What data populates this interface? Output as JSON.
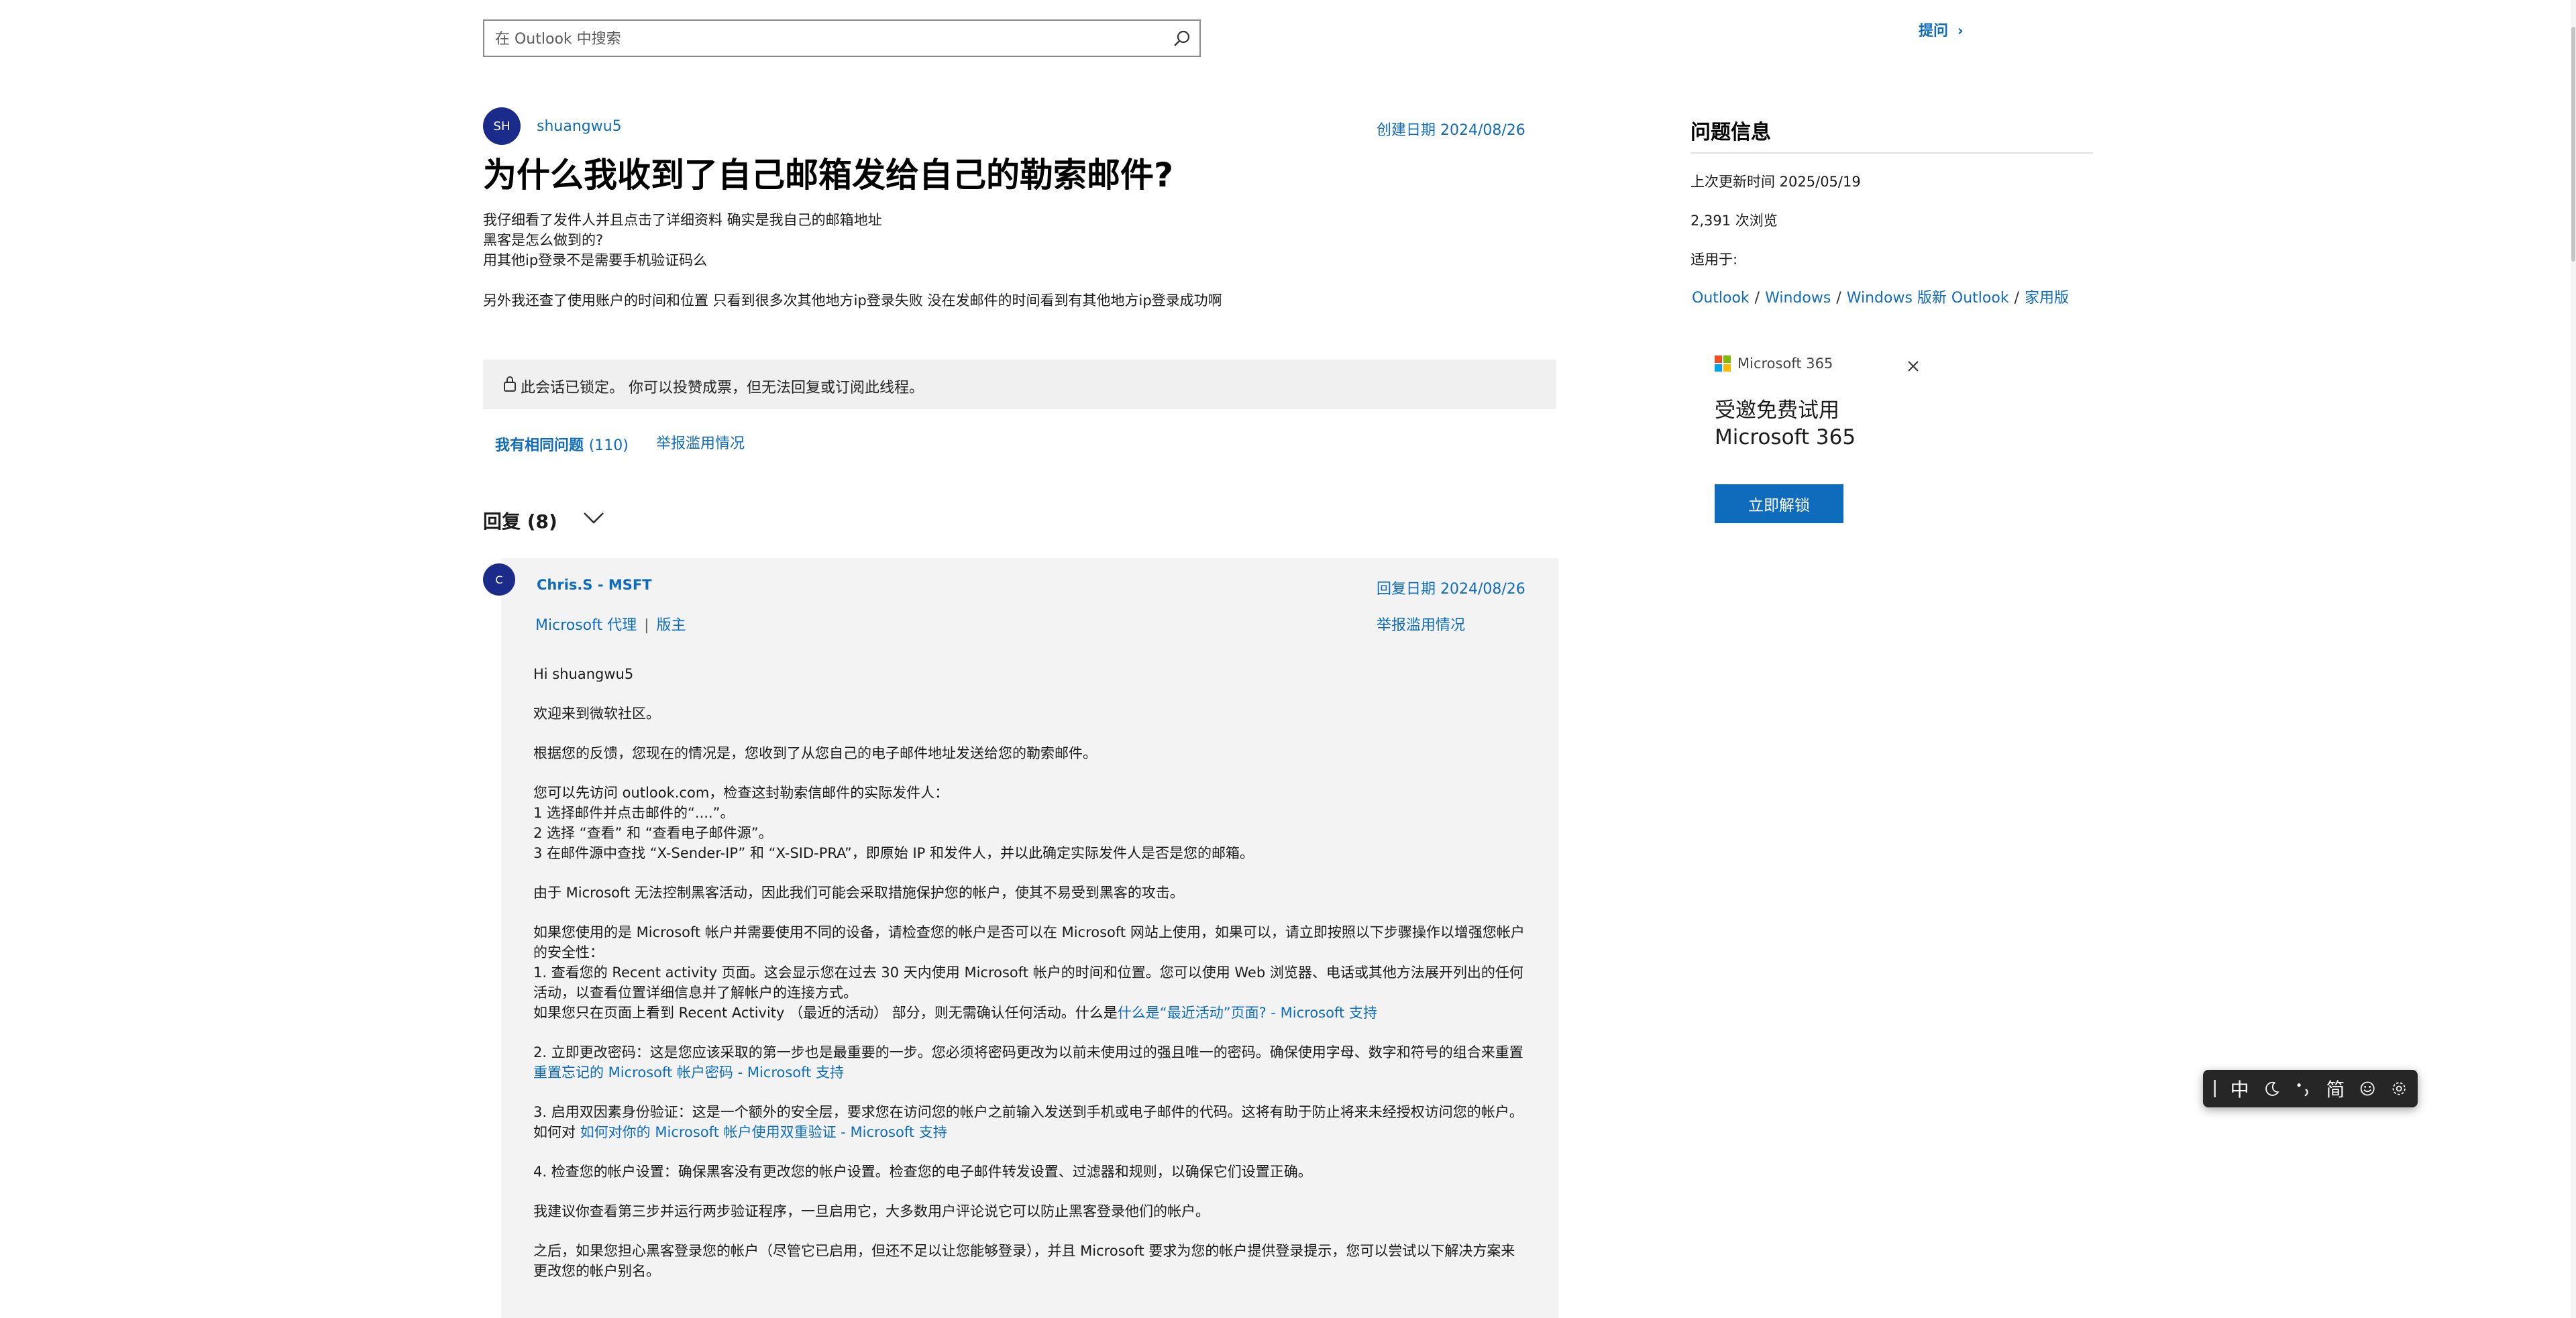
{
  "search": {
    "placeholder": "在 Outlook 中搜索"
  },
  "header": {
    "ask_label": "提问"
  },
  "question": {
    "avatar_initials": "SH",
    "author": "shuangwu5",
    "created": "创建日期 2024/08/26",
    "title": "为什么我收到了自己邮箱发给自己的勒索邮件?",
    "body_lines": [
      "我仔细看了发件人并且点击了详细资料 确实是我自己的邮箱地址",
      "黑客是怎么做到的?",
      "用其他ip登录不是需要手机验证码么",
      "另外我还查了使用账户的时间和位置 只看到很多次其他地方ip登录失败 没在发邮件的时间看到有其他地方ip登录成功啊"
    ],
    "locked_notice": "此会话已锁定。 你可以投赞成票，但无法回复或订阅此线程。",
    "same_question_label": "我有相同问题",
    "same_question_count": "(110)",
    "report_label": "举报滥用情况"
  },
  "replies": {
    "header": "回复 (8)",
    "first": {
      "avatar_initials": "C",
      "author": "Chris.S - MSFT",
      "reply_date": "回复日期 2024/08/26",
      "role": "Microsoft 代理",
      "role2": "版主",
      "report_label": "举报滥用情况",
      "p1": "Hi shuangwu5",
      "p2": "欢迎来到微软社区。",
      "p3": "根据您的反馈，您现在的情况是，您收到了从您自己的电子邮件地址发送给您的勒索邮件。",
      "p4_l1": "您可以先访问 outlook.com，检查这封勒索信邮件的实际发件人：",
      "p4_l2": "1 选择邮件并点击邮件的“....”。",
      "p4_l3": "2 选择 “查看” 和 “查看电子邮件源”。",
      "p4_l4": "3 在邮件源中查找 “X-Sender-IP” 和 “X-SID-PRA”，即原始 IP 和发件人，并以此确定实际发件人是否是您的邮箱。",
      "p5": "由于 Microsoft 无法控制黑客活动，因此我们可能会采取措施保护您的帐户，使其不易受到黑客的攻击。",
      "p6_l1": "如果您使用的是 Microsoft 帐户并需要使用不同的设备，请检查您的帐户是否可以在 Microsoft 网站上使用，如果可以，请立即按照以下步骤操作以增强您帐户的安全性：",
      "p6_l2": "1. 查看您的 Recent activity 页面。这会显示您在过去 30 天内使用 Microsoft 帐户的时间和位置。您可以使用 Web 浏览器、电话或其他方法展开列出的任何活动，以查看位置详细信息并了解帐户的连接方式。",
      "p6_l3": "如果您只在页面上看到 Recent Activity （最近的活动） 部分，则无需确认任何活动。什么是",
      "p6_link": "什么是“最近活动”页面? - Microsoft 支持",
      "p7_text": "2. 立即更改密码：这是您应该采取的第一步也是最重要的一步。您必须将密码更改为以前未使用过的强且唯一的密码。确保使用字母、数字和符号的组合来重置",
      "p7_link": "重置忘记的 Microsoft 帐户密码 - Microsoft 支持",
      "p8_text": "3. 启用双因素身份验证：这是一个额外的安全层，要求您在访问您的帐户之前输入发送到手机或电子邮件的代码。这将有助于防止将来未经授权访问您的帐户。如何对 ",
      "p8_link": "如何对你的 Microsoft 帐户使用双重验证 - Microsoft 支持",
      "p9": "4. 检查您的帐户设置：确保黑客没有更改您的帐户设置。检查您的电子邮件转发设置、过滤器和规则，以确保它们设置正确。",
      "p10": "我建议你查看第三步并运行两步验证程序，一旦启用它，大多数用户评论说它可以防止黑客登录他们的帐户。",
      "p11": "之后，如果您担心黑客登录您的帐户（尽管它已启用，但还不足以让您能够登录），并且 Microsoft 要求为您的帐户提供登录提示，您可以尝试以下解决方案来更改您的帐户别名。"
    }
  },
  "sidebar": {
    "title": "问题信息",
    "last_updated": "上次更新时间 2025/05/19",
    "views": "2,391 次浏览",
    "applies_to": "适用于:",
    "crumbs": [
      "Outlook",
      "Windows",
      "Windows 版新 Outlook",
      "家用版"
    ],
    "crumb_sep": "/"
  },
  "ad": {
    "brand": "Microsoft 365",
    "line1": "受邀免费试用",
    "line2": "Microsoft 365",
    "button": "立即解锁"
  },
  "ime": {
    "items": [
      "中",
      "简"
    ]
  },
  "colors": {
    "link": "#0f6cbd",
    "avatar": "#1a2b8a",
    "card_bg": "#f3f3f3"
  }
}
